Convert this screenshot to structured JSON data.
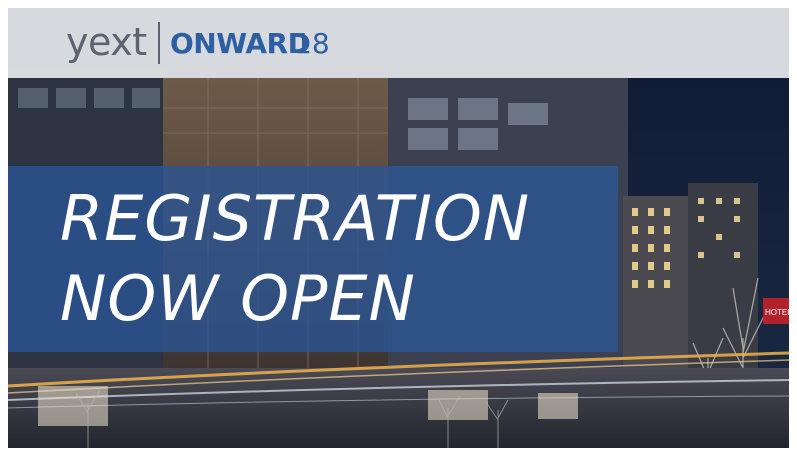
{
  "header": {
    "brand": "yext",
    "event_name": "ONWARD",
    "event_year": "18"
  },
  "hero": {
    "line1": "REGISTRATION",
    "line2": "NOW OPEN"
  },
  "background": {
    "sign_text": "HOTEL"
  },
  "colors": {
    "band": "#2a5696",
    "onward_blue": "#2f5fa3",
    "yext_gray": "#5b6470",
    "header_bg": "#eceef0",
    "night_sky": "#131a2c"
  }
}
